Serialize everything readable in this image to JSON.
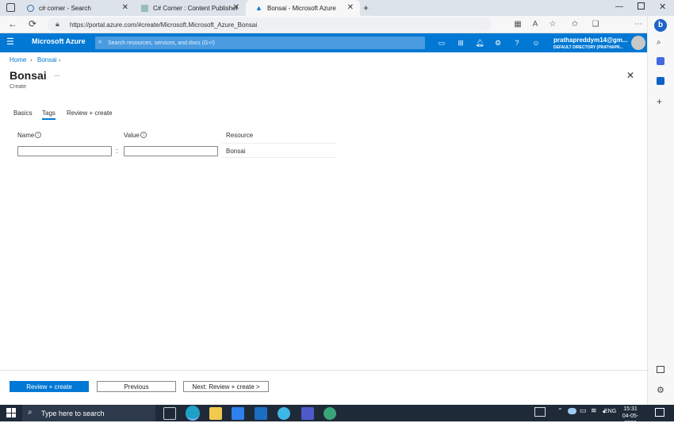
{
  "browser": {
    "tabs": [
      {
        "title": "c# corner - Search"
      },
      {
        "title": "C# Corner : Content Publisher"
      },
      {
        "title": "Bonsai - Microsoft Azure"
      }
    ],
    "url": "https://portal.azure.com/#create/Microsoft.Microsoft_Azure_Bonsai"
  },
  "azure": {
    "brand": "Microsoft Azure",
    "search_placeholder": "Search resources, services, and docs (G+/)",
    "account_name": "prathapreddym14@gm...",
    "account_dir": "DEFAULT DIRECTORY (PRATHAPR...",
    "colors": {
      "header": "#0078d4"
    }
  },
  "breadcrumb": {
    "home": "Home",
    "current": "Bonsai"
  },
  "page": {
    "title": "Bonsai",
    "more": "...",
    "subtitle": "Create"
  },
  "tabs": [
    {
      "label": "Basics"
    },
    {
      "label": "Tags"
    },
    {
      "label": "Review + create"
    }
  ],
  "tags_table": {
    "headers": {
      "name": "Name",
      "value": "Value",
      "resource": "Resource"
    },
    "row": {
      "name": "",
      "separator": ":",
      "value": "",
      "resource": "Bonsai"
    }
  },
  "footer": {
    "review_create": "Review + create",
    "previous": "Previous",
    "next": "Next: Review + create >"
  },
  "taskbar": {
    "search_placeholder": "Type here to search",
    "lang": "ENG",
    "time": "15:31",
    "date": "04-05-2023"
  }
}
